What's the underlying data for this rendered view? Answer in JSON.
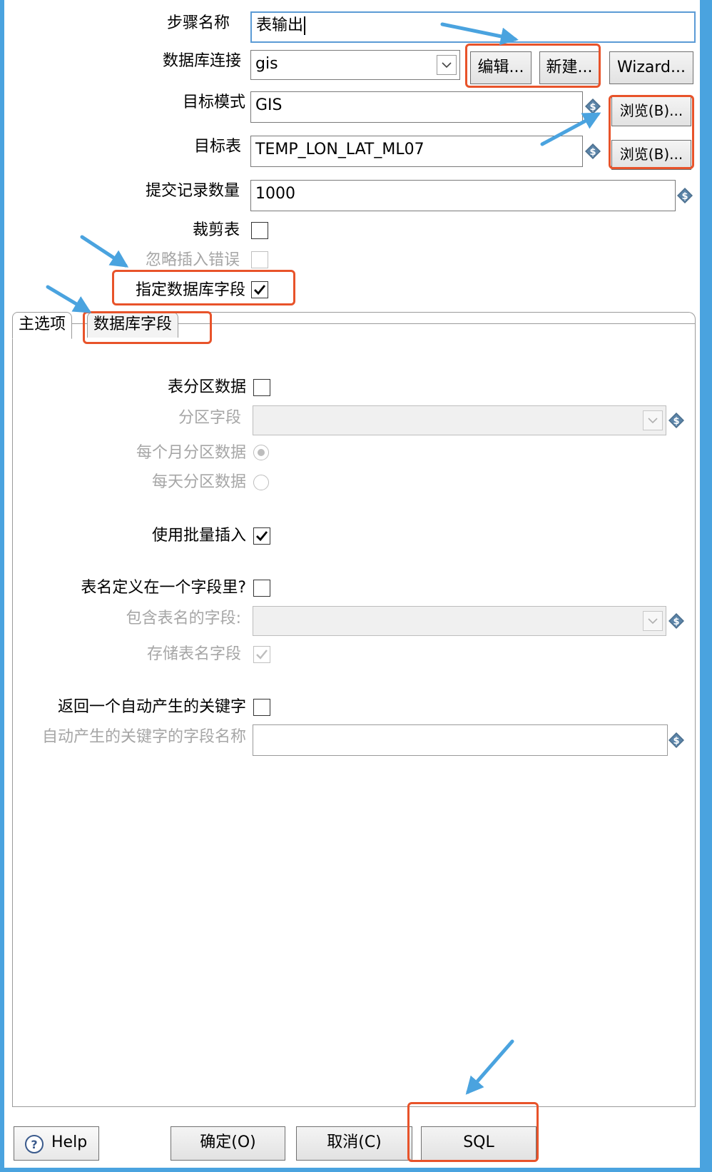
{
  "form": {
    "step_name_label": "步骤名称",
    "step_name_value": "表输出",
    "db_connection_label": "数据库连接",
    "db_connection_value": "gis",
    "edit_button": "编辑...",
    "new_button": "新建...",
    "wizard_button": "Wizard...",
    "target_schema_label": "目标模式",
    "target_schema_value": "GIS",
    "browse_schema_button": "浏览(B)...",
    "target_table_label": "目标表",
    "target_table_value": "TEMP_LON_LAT_ML07",
    "browse_table_button": "浏览(B)...",
    "commit_size_label": "提交记录数量",
    "commit_size_value": "1000",
    "truncate_label": "裁剪表",
    "ignore_errors_label": "忽略插入错误",
    "specify_fields_label": "指定数据库字段"
  },
  "tabs": [
    {
      "label": "主选项"
    },
    {
      "label": "数据库字段"
    }
  ],
  "main_tab": {
    "partition_label": "表分区数据",
    "partition_field_label": "分区字段",
    "monthly_label": "每个月分区数据",
    "daily_label": "每天分区数据",
    "batch_insert_label": "使用批量插入",
    "table_in_field_label": "表名定义在一个字段里?",
    "table_name_field_label": "包含表名的字段:",
    "store_table_name_label": "存储表名字段",
    "return_key_label": "返回一个自动产生的关键字",
    "key_field_name_label": "自动产生的关键字的字段名称"
  },
  "buttons": {
    "help": "Help",
    "ok": "确定(O)",
    "cancel": "取消(C)",
    "sql": "SQL"
  },
  "state": {
    "truncate": false,
    "ignore_errors": false,
    "specify_fields": true,
    "partition": false,
    "monthly_selected": true,
    "batch_insert": true,
    "table_in_field": false,
    "store_table_name": true,
    "return_key": false
  },
  "colors": {
    "highlight": "#e8532a",
    "arrow": "#4aa3df",
    "frame": "#4aa3df"
  }
}
